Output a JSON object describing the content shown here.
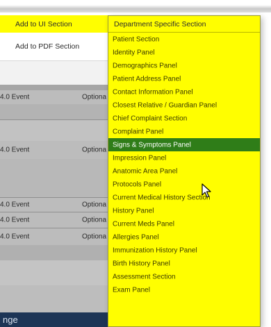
{
  "form": {
    "ui_section_label": "Add to UI Section",
    "pdf_section_label": "Add to PDF Section"
  },
  "table": {
    "rows": [
      {
        "event": "4.0 Event",
        "option": "Optiona"
      },
      {
        "event": "4.0 Event",
        "option": "Optiona"
      },
      {
        "event": "4.0 Event",
        "option": "Optiona"
      },
      {
        "event": "4.0 Event",
        "option": "Optiona"
      },
      {
        "event": "4.0 Event",
        "option": "Optiona"
      }
    ],
    "bottom_text": "nge"
  },
  "dropdown": {
    "selected_value": "Department Specific Section",
    "options": [
      "Patient Section",
      "Identity Panel",
      "Demographics Panel",
      "Patient Address Panel",
      "Contact Information Panel",
      "Closest Relative / Guardian Panel",
      "Chief Complaint Section",
      "Complaint Panel",
      "Signs & Symptoms Panel",
      "Impression Panel",
      "Anatomic Area Panel",
      "Protocols Panel",
      "Current Medical History Section",
      "History Panel",
      "Current Meds Panel",
      "Allergies Panel",
      "Immunization History Panel",
      "Birth History Panel",
      "Assessment Section",
      "Exam Panel"
    ],
    "highlighted_option": "Signs & Symptoms Panel"
  },
  "colors": {
    "field_yellow": "#fffe00",
    "highlight_green": "#2f7d18",
    "table_grey": "#bcbcbc",
    "bottom_navy": "#1d3556"
  }
}
